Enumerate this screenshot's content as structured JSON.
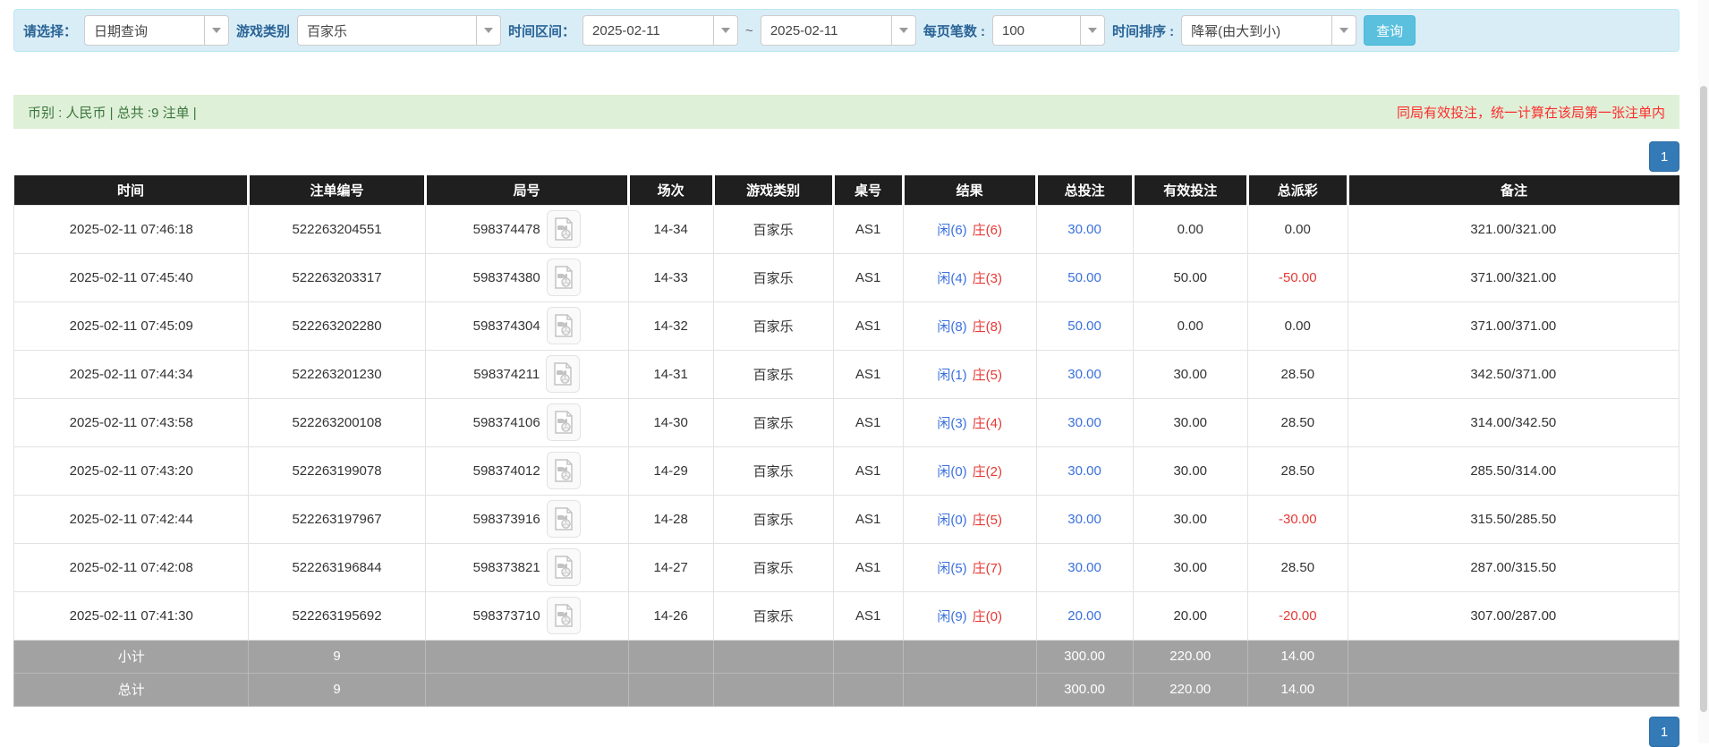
{
  "filters": {
    "select_label": "请选择：",
    "query_type": "日期查询",
    "game_category_label": "游戏类别",
    "game_category": "百家乐",
    "time_range_label": "时间区间：",
    "date_from": "2025-02-11",
    "tilde": "~",
    "date_to": "2025-02-11",
    "page_size_label": "每页笔数 :",
    "page_size": "100",
    "sort_label": "时间排序 :",
    "sort_value": "降幂(由大到小)",
    "query_button": "查询"
  },
  "summary": {
    "left": "币别 : 人民币 | 总共 :9 注单 |",
    "right_note": "同局有效投注，统一计算在该局第一张注单内"
  },
  "pagination": {
    "page": "1"
  },
  "colors": {
    "filter_bar_bg": "#d9edf7",
    "summary_bar_bg": "#dff0d8",
    "header_bg": "#1f1f1f",
    "totals_bg": "#a2a2a2",
    "accent_blue": "#3a70dd",
    "accent_red": "#e53935",
    "note_red": "#fe2c2c",
    "pager_blue": "#337ab7",
    "query_btn": "#5bc0de"
  },
  "table": {
    "headers": [
      "时间",
      "注单编号",
      "局号",
      "场次",
      "游戏类别",
      "桌号",
      "结果",
      "总投注",
      "有效投注",
      "总派彩",
      "备注"
    ],
    "rows": [
      {
        "time": "2025-02-11 07:46:18",
        "bet_no": "522263204551",
        "round_no": "598374478",
        "session": "14-34",
        "game": "百家乐",
        "table_no": "AS1",
        "result_xian": "闲(6)",
        "result_zhuang": "庄(6)",
        "total_bet": "30.00",
        "valid_bet": "0.00",
        "payout": "0.00",
        "remark": "321.00/321.00"
      },
      {
        "time": "2025-02-11 07:45:40",
        "bet_no": "522263203317",
        "round_no": "598374380",
        "session": "14-33",
        "game": "百家乐",
        "table_no": "AS1",
        "result_xian": "闲(4)",
        "result_zhuang": "庄(3)",
        "total_bet": "50.00",
        "valid_bet": "50.00",
        "payout": "-50.00",
        "remark": "371.00/321.00"
      },
      {
        "time": "2025-02-11 07:45:09",
        "bet_no": "522263202280",
        "round_no": "598374304",
        "session": "14-32",
        "game": "百家乐",
        "table_no": "AS1",
        "result_xian": "闲(8)",
        "result_zhuang": "庄(8)",
        "total_bet": "50.00",
        "valid_bet": "0.00",
        "payout": "0.00",
        "remark": "371.00/371.00"
      },
      {
        "time": "2025-02-11 07:44:34",
        "bet_no": "522263201230",
        "round_no": "598374211",
        "session": "14-31",
        "game": "百家乐",
        "table_no": "AS1",
        "result_xian": "闲(1)",
        "result_zhuang": "庄(5)",
        "total_bet": "30.00",
        "valid_bet": "30.00",
        "payout": "28.50",
        "remark": "342.50/371.00"
      },
      {
        "time": "2025-02-11 07:43:58",
        "bet_no": "522263200108",
        "round_no": "598374106",
        "session": "14-30",
        "game": "百家乐",
        "table_no": "AS1",
        "result_xian": "闲(3)",
        "result_zhuang": "庄(4)",
        "total_bet": "30.00",
        "valid_bet": "30.00",
        "payout": "28.50",
        "remark": "314.00/342.50"
      },
      {
        "time": "2025-02-11 07:43:20",
        "bet_no": "522263199078",
        "round_no": "598374012",
        "session": "14-29",
        "game": "百家乐",
        "table_no": "AS1",
        "result_xian": "闲(0)",
        "result_zhuang": "庄(2)",
        "total_bet": "30.00",
        "valid_bet": "30.00",
        "payout": "28.50",
        "remark": "285.50/314.00"
      },
      {
        "time": "2025-02-11 07:42:44",
        "bet_no": "522263197967",
        "round_no": "598373916",
        "session": "14-28",
        "game": "百家乐",
        "table_no": "AS1",
        "result_xian": "闲(0)",
        "result_zhuang": "庄(5)",
        "total_bet": "30.00",
        "valid_bet": "30.00",
        "payout": "-30.00",
        "remark": "315.50/285.50"
      },
      {
        "time": "2025-02-11 07:42:08",
        "bet_no": "522263196844",
        "round_no": "598373821",
        "session": "14-27",
        "game": "百家乐",
        "table_no": "AS1",
        "result_xian": "闲(5)",
        "result_zhuang": "庄(7)",
        "total_bet": "30.00",
        "valid_bet": "30.00",
        "payout": "28.50",
        "remark": "287.00/315.50"
      },
      {
        "time": "2025-02-11 07:41:30",
        "bet_no": "522263195692",
        "round_no": "598373710",
        "session": "14-26",
        "game": "百家乐",
        "table_no": "AS1",
        "result_xian": "闲(9)",
        "result_zhuang": "庄(0)",
        "total_bet": "20.00",
        "valid_bet": "20.00",
        "payout": "-20.00",
        "remark": "307.00/287.00"
      }
    ],
    "subtotal": {
      "label": "小计",
      "count": "9",
      "total_bet": "300.00",
      "valid_bet": "220.00",
      "payout": "14.00"
    },
    "total": {
      "label": "总计",
      "count": "9",
      "total_bet": "300.00",
      "valid_bet": "220.00",
      "payout": "14.00"
    }
  }
}
